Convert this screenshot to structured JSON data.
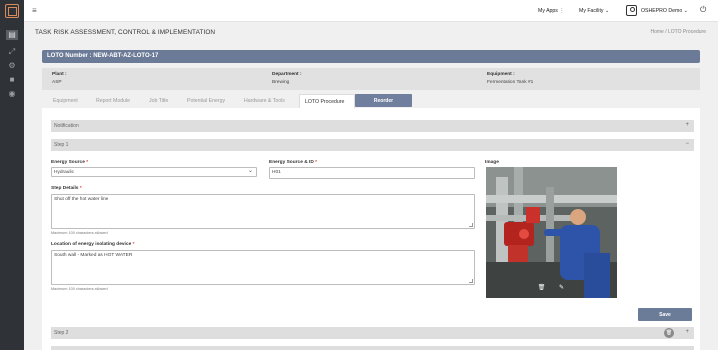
{
  "header": {
    "my_apps": "My Apps",
    "my_facility": "My Facility",
    "user": "OSHEPRO Demo"
  },
  "page": {
    "title": "TASK RISK ASSESSMENT, CONTROL & IMPLEMENTATION",
    "breadcrumb_home": "Home",
    "breadcrumb_sep": "/",
    "breadcrumb_current": "LOTO Procedure"
  },
  "loto": {
    "number_label": "LOTO Number : NEW-ABT-AZ-LOTO-17"
  },
  "info": {
    "plant_label": "Plant :",
    "plant_value": "ASP",
    "department_label": "Department :",
    "department_value": "Brewing",
    "equipment_label": "Equipment :",
    "equipment_value": "Fermentation Tank #1"
  },
  "tabs": [
    {
      "label": "Equipment"
    },
    {
      "label": "Report Module"
    },
    {
      "label": "Job Title"
    },
    {
      "label": "Potential Energy"
    },
    {
      "label": "Hardware & Tools"
    },
    {
      "label": "LOTO Procedure"
    }
  ],
  "reorder_label": "Reorder",
  "notification": {
    "label": "Notification",
    "sign": "+"
  },
  "step1": {
    "label": "Step 1",
    "sign": "−",
    "energy_source_label": "Energy Source",
    "energy_source_value": "Hydraulic",
    "energy_id_label": "Energy Source & ID",
    "energy_id_value": "H01",
    "image_label": "Image",
    "step_details_label": "Step Details",
    "step_details_value": "Shut off the hot water line",
    "hint1": "Maximum 100 characters allowed",
    "location_label": "Location of energy isolating device",
    "location_value": "South wall - Marked as HOT WATER",
    "hint2": "Maximum 100 characters allowed",
    "required_mark": "*",
    "save_label": "Save"
  },
  "step2": {
    "label": "Step 2",
    "sign": "+"
  }
}
